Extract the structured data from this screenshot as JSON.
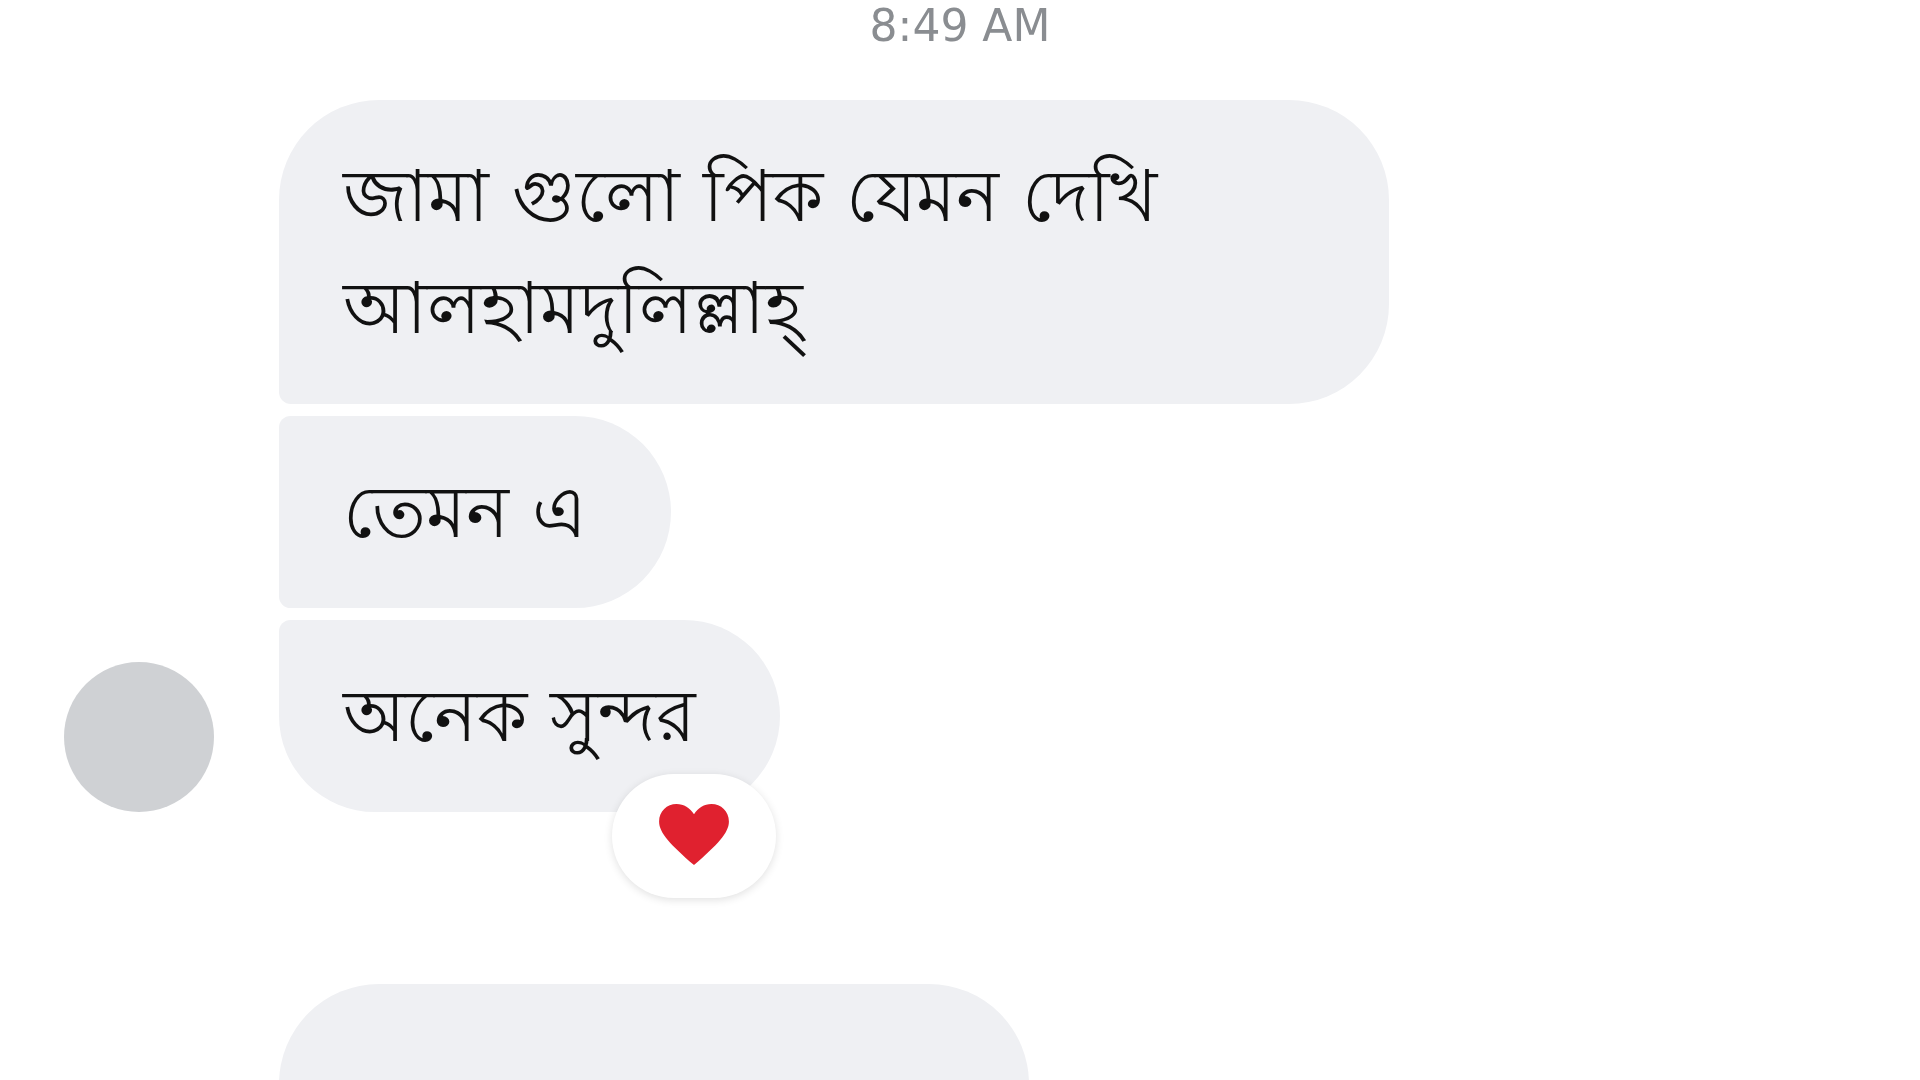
{
  "timestamp": "8:49 AM",
  "messages": [
    {
      "text": "জামা গুলো পিক যেমন দেখি আলহামদুলিল্লাহ্",
      "kind": "first",
      "reaction": false
    },
    {
      "text": "তেমন এ",
      "kind": "middle",
      "reaction": false
    },
    {
      "text": "অনেক সুন্দর",
      "kind": "last",
      "reaction": true
    },
    {
      "kind": "cut",
      "reaction": false
    }
  ]
}
